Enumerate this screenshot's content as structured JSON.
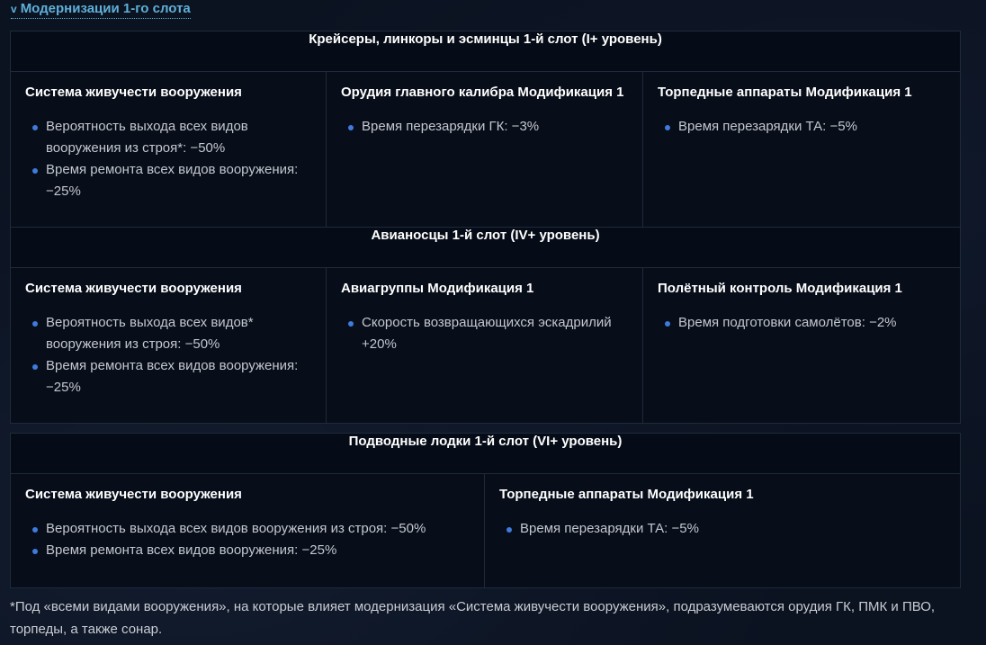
{
  "section": {
    "chevron": "v",
    "title": "Модернизации 1-го слота"
  },
  "tables": [
    {
      "header": "Крейсеры, линкоры и эсминцы 1-й слот (I+ уровень)",
      "cells": [
        {
          "title": "Система живучести вооружения",
          "items": [
            "Вероятность выхода всех видов вооружения из строя*: −50%",
            "Время ремонта всех видов вооружения: −25%"
          ]
        },
        {
          "title": "Орудия главного калибра Модификация 1",
          "items": [
            "Время перезарядки ГК: −3%"
          ]
        },
        {
          "title": "Торпедные аппараты Модификация 1",
          "items": [
            "Время перезарядки ТА: −5%"
          ]
        }
      ]
    },
    {
      "header": "Авианосцы 1-й слот (IV+ уровень)",
      "cells": [
        {
          "title": "Система живучести вооружения",
          "items": [
            "Вероятность выхода всех видов* вооружения из строя: −50%",
            "Время ремонта всех видов вооружения: −25%"
          ]
        },
        {
          "title": "Авиагруппы Модификация 1",
          "items": [
            "Скорость возвращающихся эскадрилий +20%"
          ]
        },
        {
          "title": "Полётный контроль Модификация 1",
          "items": [
            "Время подготовки самолётов: −2%"
          ]
        }
      ]
    },
    {
      "header": "Подводные лодки 1-й слот (VI+ уровень)",
      "cells": [
        {
          "title": "Система живучести вооружения",
          "items": [
            "Вероятность выхода всех видов вооружения из строя: −50%",
            "Время ремонта всех видов вооружения: −25%"
          ]
        },
        {
          "title": "Торпедные аппараты Модификация 1",
          "items": [
            "Время перезарядки ТА: −5%"
          ]
        }
      ]
    }
  ],
  "footnote": "*Под «всеми видами вооружения», на которые влияет модернизация «Система живучести вооружения», подразумеваются орудия ГК, ПМК и ПВО, торпеды, а также сонар.",
  "colors": {
    "accent": "#5fb0d9",
    "bullet": "#3f7bdc",
    "background": "#0b1220"
  },
  "icons": {
    "chevron": "chevron-down-icon"
  }
}
